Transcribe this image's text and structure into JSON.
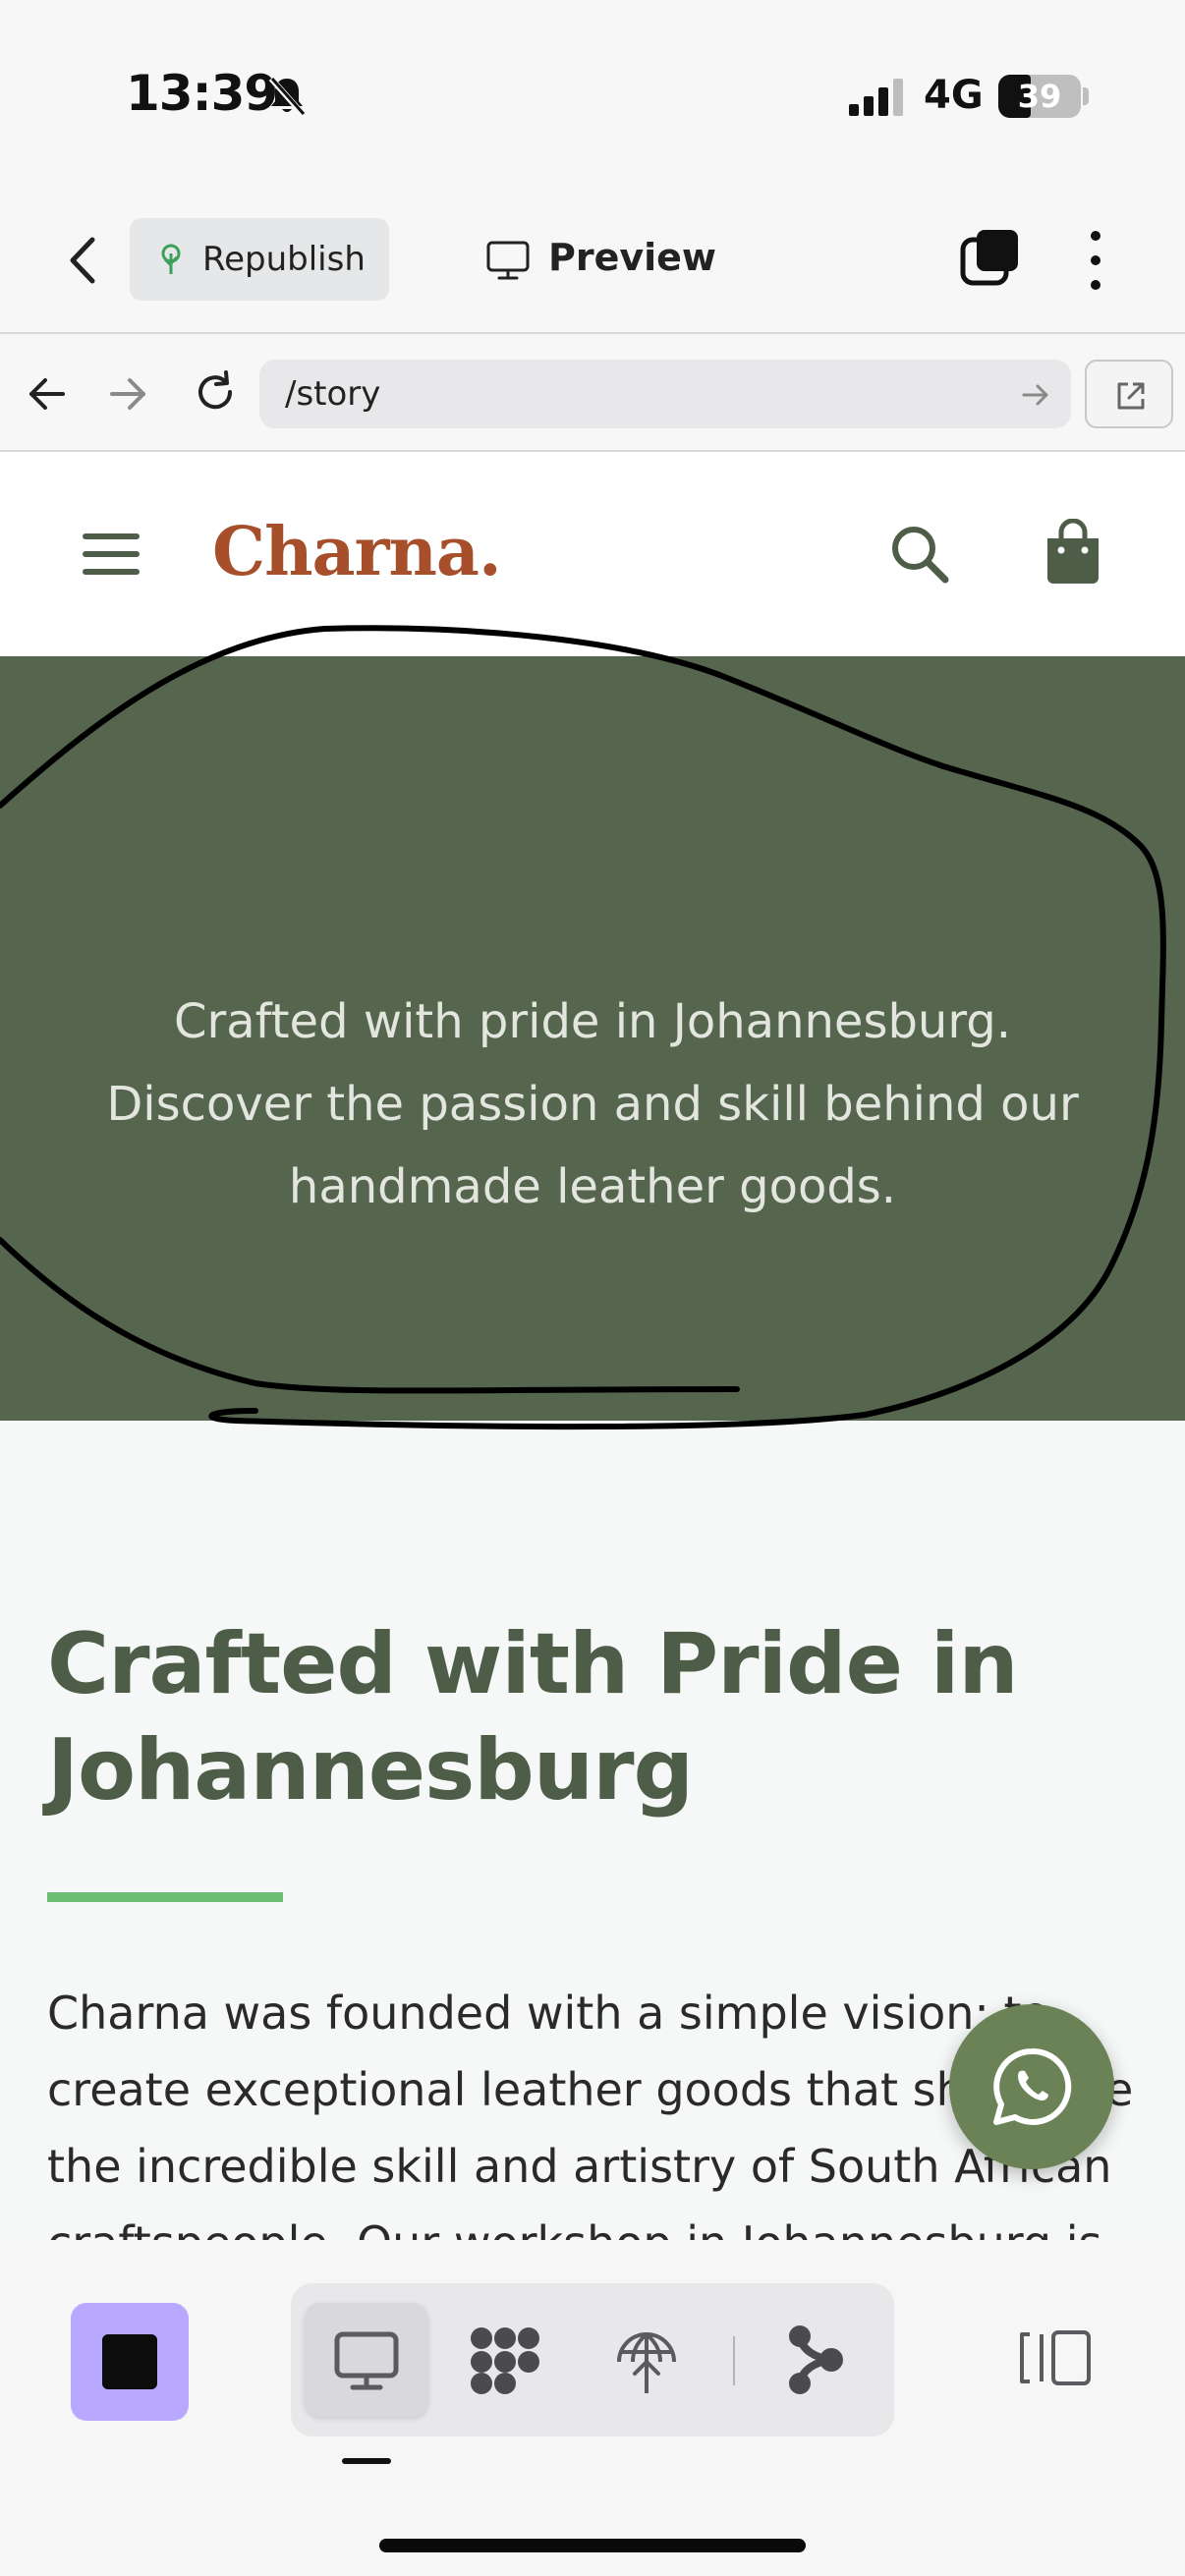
{
  "status_bar": {
    "time": "13:39",
    "network": "4G",
    "battery": "39",
    "battery_level": 0.39
  },
  "editor_bar": {
    "republish_label": "Republish",
    "preview_label": "Preview"
  },
  "browser_bar": {
    "url": "/story"
  },
  "site": {
    "logo": "Charna.",
    "hero_lines": [
      "Crafted with pride in Johannesburg.",
      "Discover the passion and skill behind our",
      "handmade leather goods."
    ],
    "story_title_lines": [
      "Crafted with Pride in",
      "Johannesburg"
    ],
    "story_body": "Charna was founded with a simple vision: to create exceptional leather goods that showcase the incredible skill and artistry of South African craftspeople. Our workshop in Johannesburg is"
  },
  "colors": {
    "brand": "#a74f2b",
    "hero_bg": "#55654e",
    "heading": "#4d5d48",
    "accent_rule": "#6dbf73",
    "whatsapp_bg": "#6a8255",
    "stop_button": "#b8a8ff"
  },
  "icons": {
    "status": [
      "bell-slash-icon",
      "signal-icon",
      "battery-icon"
    ],
    "editor": [
      "chevron-left-icon",
      "tree-icon",
      "monitor-icon",
      "layers-icon",
      "more-vertical-icon"
    ],
    "browser": [
      "arrow-left-icon",
      "arrow-right-icon",
      "reload-icon",
      "arrow-right-small-icon",
      "external-link-icon"
    ],
    "site": [
      "hamburger-icon",
      "search-icon",
      "shopping-bag-icon",
      "whatsapp-icon"
    ],
    "bottom": [
      "stop-icon",
      "desktop-icon",
      "components-icon",
      "globe-upload-icon",
      "flow-icon",
      "panel-toggle-icon"
    ]
  }
}
